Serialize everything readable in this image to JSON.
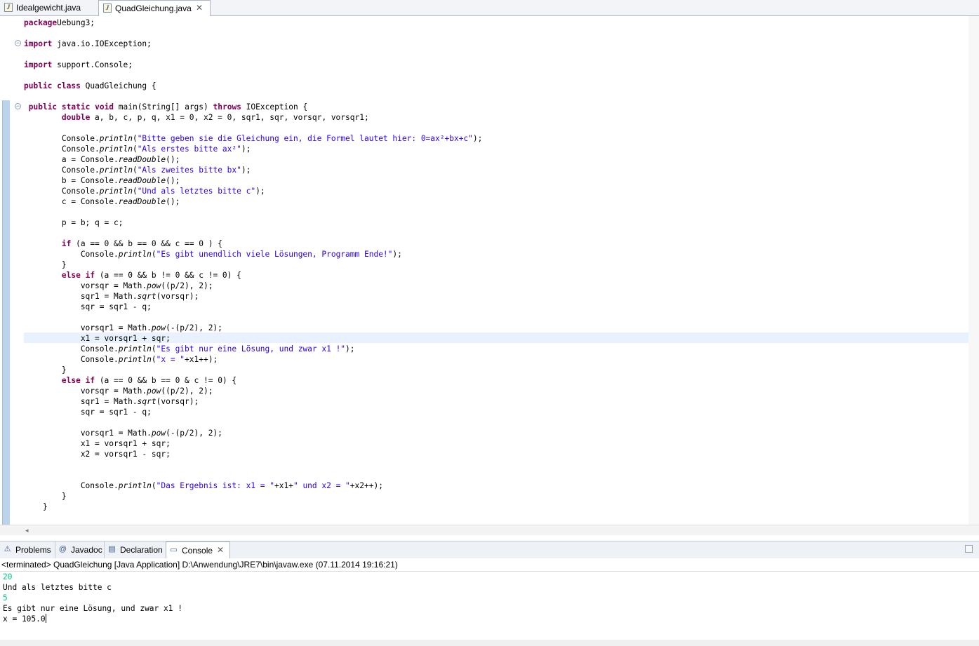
{
  "editor_tabs": [
    {
      "label": "Idealgewicht.java",
      "icon": "java-file-icon",
      "active": false
    },
    {
      "label": "QuadGleichung.java",
      "icon": "java-file-icon",
      "active": true,
      "close": "✕"
    }
  ],
  "code_lines": [
    [
      [
        "kw",
        "package"
      ],
      [
        "",
        "Uebung3;"
      ]
    ],
    [],
    [
      [
        "kw",
        "import"
      ],
      [
        "",
        " java.io.IOException;"
      ]
    ],
    [],
    [
      [
        "kw",
        "import"
      ],
      [
        "",
        " support.Console;"
      ]
    ],
    [],
    [
      [
        "kw",
        "public"
      ],
      [
        "",
        " "
      ],
      [
        "kw",
        "class"
      ],
      [
        "",
        " QuadGleichung {"
      ]
    ],
    [],
    [
      [
        "",
        " "
      ],
      [
        "kw",
        "public"
      ],
      [
        "",
        " "
      ],
      [
        "kw",
        "static"
      ],
      [
        "",
        " "
      ],
      [
        "kw",
        "void"
      ],
      [
        "",
        " main(String[] args) "
      ],
      [
        "kw",
        "throws"
      ],
      [
        "",
        " IOException {"
      ]
    ],
    [
      [
        "",
        "        "
      ],
      [
        "kw",
        "double"
      ],
      [
        "",
        " a, b, c, p, q, x1 = 0, x2 = 0, sqr1, sqr, vorsqr, vorsqr1;"
      ]
    ],
    [],
    [
      [
        "",
        "        Console."
      ],
      [
        "it",
        "println"
      ],
      [
        "",
        "("
      ],
      [
        "str",
        "\"Bitte geben sie die Gleichung ein, die Formel lautet hier: 0=ax²+bx+c\""
      ],
      [
        "",
        ");"
      ]
    ],
    [
      [
        "",
        "        Console."
      ],
      [
        "it",
        "println"
      ],
      [
        "",
        "("
      ],
      [
        "str",
        "\"Als erstes bitte ax²\""
      ],
      [
        "",
        ");"
      ]
    ],
    [
      [
        "",
        "        a = Console."
      ],
      [
        "it",
        "readDouble"
      ],
      [
        "",
        "();"
      ]
    ],
    [
      [
        "",
        "        Console."
      ],
      [
        "it",
        "println"
      ],
      [
        "",
        "("
      ],
      [
        "str",
        "\"Als zweites bitte bx\""
      ],
      [
        "",
        ");"
      ]
    ],
    [
      [
        "",
        "        b = Console."
      ],
      [
        "it",
        "readDouble"
      ],
      [
        "",
        "();"
      ]
    ],
    [
      [
        "",
        "        Console."
      ],
      [
        "it",
        "println"
      ],
      [
        "",
        "("
      ],
      [
        "str",
        "\"Und als letztes bitte c\""
      ],
      [
        "",
        ");"
      ]
    ],
    [
      [
        "",
        "        c = Console."
      ],
      [
        "it",
        "readDouble"
      ],
      [
        "",
        "();"
      ]
    ],
    [],
    [
      [
        "",
        "        p = b; q = c;"
      ]
    ],
    [],
    [
      [
        "",
        "        "
      ],
      [
        "kw",
        "if"
      ],
      [
        "",
        " (a == 0 && b == 0 && c == 0 ) {"
      ]
    ],
    [
      [
        "",
        "            Console."
      ],
      [
        "it",
        "println"
      ],
      [
        "",
        "("
      ],
      [
        "str",
        "\"Es gibt unendlich viele Lösungen, Programm Ende!\""
      ],
      [
        "",
        ");"
      ]
    ],
    [
      [
        "",
        "        }"
      ]
    ],
    [
      [
        "",
        "        "
      ],
      [
        "kw",
        "else"
      ],
      [
        "",
        " "
      ],
      [
        "kw",
        "if"
      ],
      [
        "",
        " (a == 0 && b != 0 && c != 0) {"
      ]
    ],
    [
      [
        "",
        "            vorsqr = Math."
      ],
      [
        "it",
        "pow"
      ],
      [
        "",
        "((p/2), 2);"
      ]
    ],
    [
      [
        "",
        "            sqr1 = Math."
      ],
      [
        "it",
        "sqrt"
      ],
      [
        "",
        "(vorsqr);"
      ]
    ],
    [
      [
        "",
        "            sqr = sqr1 - q;"
      ]
    ],
    [],
    [
      [
        "",
        "            vorsqr1 = Math."
      ],
      [
        "it",
        "pow"
      ],
      [
        "",
        "(-(p/2), 2);"
      ]
    ],
    [
      [
        "",
        "            x1 = vorsqr1 + sqr;"
      ]
    ],
    [
      [
        "",
        "            Console."
      ],
      [
        "it",
        "println"
      ],
      [
        "",
        "("
      ],
      [
        "str",
        "\"Es gibt nur eine Lösung, und zwar x1 !\""
      ],
      [
        "",
        ");"
      ]
    ],
    [
      [
        "",
        "            Console."
      ],
      [
        "it",
        "println"
      ],
      [
        "",
        "("
      ],
      [
        "str",
        "\"x = \""
      ],
      [
        "",
        "+x1++);"
      ]
    ],
    [
      [
        "",
        "        }"
      ]
    ],
    [
      [
        "",
        "        "
      ],
      [
        "kw",
        "else"
      ],
      [
        "",
        " "
      ],
      [
        "kw",
        "if"
      ],
      [
        "",
        " (a == 0 && b == 0 & c != 0) {"
      ]
    ],
    [
      [
        "",
        "            vorsqr = Math."
      ],
      [
        "it",
        "pow"
      ],
      [
        "",
        "((p/2), 2);"
      ]
    ],
    [
      [
        "",
        "            sqr1 = Math."
      ],
      [
        "it",
        "sqrt"
      ],
      [
        "",
        "(vorsqr);"
      ]
    ],
    [
      [
        "",
        "            sqr = sqr1 - q;"
      ]
    ],
    [],
    [
      [
        "",
        "            vorsqr1 = Math."
      ],
      [
        "it",
        "pow"
      ],
      [
        "",
        "(-(p/2), 2);"
      ]
    ],
    [
      [
        "",
        "            x1 = vorsqr1 + sqr;"
      ]
    ],
    [
      [
        "",
        "            x2 = vorsqr1 - sqr;"
      ]
    ],
    [],
    [],
    [
      [
        "",
        "            Console."
      ],
      [
        "it",
        "println"
      ],
      [
        "",
        "("
      ],
      [
        "str",
        "\"Das Ergebnis ist: x1 = \""
      ],
      [
        "",
        "+x1+"
      ],
      [
        "str",
        "\" und x2 = \""
      ],
      [
        "",
        "+x2++);"
      ]
    ],
    [
      [
        "",
        "        }"
      ]
    ],
    [
      [
        "",
        "    }"
      ]
    ]
  ],
  "view_tabs": [
    {
      "label": "Problems",
      "icon": "problems-icon",
      "active": false
    },
    {
      "label": "Javadoc",
      "icon": "javadoc-icon",
      "active": false
    },
    {
      "label": "Declaration",
      "icon": "declaration-icon",
      "active": false
    },
    {
      "label": "Console",
      "icon": "console-icon",
      "active": true,
      "close": "✕"
    }
  ],
  "console": {
    "description": "<terminated> QuadGleichung [Java Application] D:\\Anwendung\\JRE7\\bin\\javaw.exe (07.11.2014 19:16:21)",
    "lines": [
      {
        "type": "in",
        "text": "20"
      },
      {
        "type": "out",
        "text": "Und als letztes bitte c"
      },
      {
        "type": "in",
        "text": "5"
      },
      {
        "type": "out",
        "text": "Es gibt nur eine Lösung, und zwar x1 !"
      },
      {
        "type": "out",
        "text": "x = 105.0"
      }
    ]
  },
  "colors": {
    "keyword": "#7f0055",
    "string": "#2a00ff",
    "console_input": "#00c87d",
    "current_line": "#e8f2fe"
  }
}
